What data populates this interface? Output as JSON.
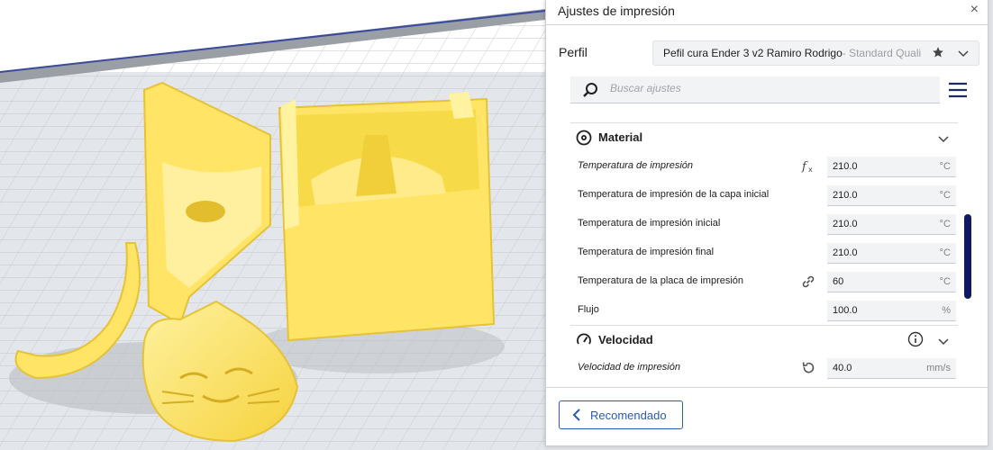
{
  "panel": {
    "title": "Ajustes de impresión",
    "close_icon": "close-icon"
  },
  "profile": {
    "label": "Perfil",
    "name": "Pefil cura Ender 3 v2 Ramiro Rodrigo",
    "quality": " - Standard Quali...",
    "star_icon": "star-icon",
    "chevron_icon": "chevron-down-icon"
  },
  "search": {
    "placeholder": "Buscar ajustes",
    "icon": "search-icon",
    "menu_icon": "hamburger-menu-icon"
  },
  "categories": [
    {
      "title": "Material",
      "icon": "material-spool-icon",
      "settings": [
        {
          "label": "Temperatura de impresión",
          "value": "210.0",
          "unit": "°C",
          "icon": "function-fx-icon",
          "italic": true
        },
        {
          "label": "Temperatura de impresión de la capa inicial",
          "value": "210.0",
          "unit": "°C",
          "italic": false
        },
        {
          "label": "Temperatura de impresión inicial",
          "value": "210.0",
          "unit": "°C",
          "italic": false
        },
        {
          "label": "Temperatura de impresión final",
          "value": "210.0",
          "unit": "°C",
          "italic": false
        },
        {
          "label": "Temperatura de la placa de impresión",
          "value": "60",
          "unit": "°C",
          "icon": "link-icon",
          "italic": false
        },
        {
          "label": "Flujo",
          "value": "100.0",
          "unit": "%",
          "italic": false
        }
      ]
    },
    {
      "title": "Velocidad",
      "icon": "speed-gauge-icon",
      "info_icon": "info-icon",
      "settings": [
        {
          "label": "Velocidad de impresión",
          "value": "40.0",
          "unit": "mm/s",
          "icon": "reset-icon",
          "italic": true
        }
      ]
    }
  ],
  "footer": {
    "recommended_label": "Recomendado",
    "back_icon": "chevron-left-icon"
  },
  "colors": {
    "model_yellow": "#ffe466",
    "accent_blue": "#2a5bb5",
    "scrollbar": "#0f1a5c"
  }
}
